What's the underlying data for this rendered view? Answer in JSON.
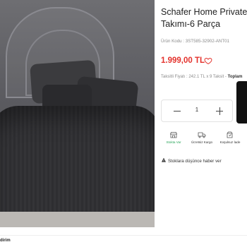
{
  "product": {
    "title_line1": "Schafer Home Private Çi",
    "title_line2": "Takımı-6 Parça",
    "sku_text": "Ürün Kodu : 3ST585-32902-ANT01",
    "price": "1.999,00 TL",
    "installment_text": "Taksitli Fiyatı : 242.1 TL x 9 Taksit - ",
    "installment_bold": "Toplam",
    "quantity": "1",
    "notify_text": "Stoklara düşünce haber ver"
  },
  "features": [
    {
      "label": "Stokta Var",
      "icon": "store-icon"
    },
    {
      "label": "Ücretsiz Kargo",
      "icon": "truck-icon"
    },
    {
      "label": "Koşulsuz İade",
      "icon": "return-icon"
    }
  ],
  "footer": {
    "partial_text": "dirim"
  },
  "colors": {
    "price": "#e4322c",
    "stock": "#2aa55a",
    "cart_button": "#111111"
  }
}
